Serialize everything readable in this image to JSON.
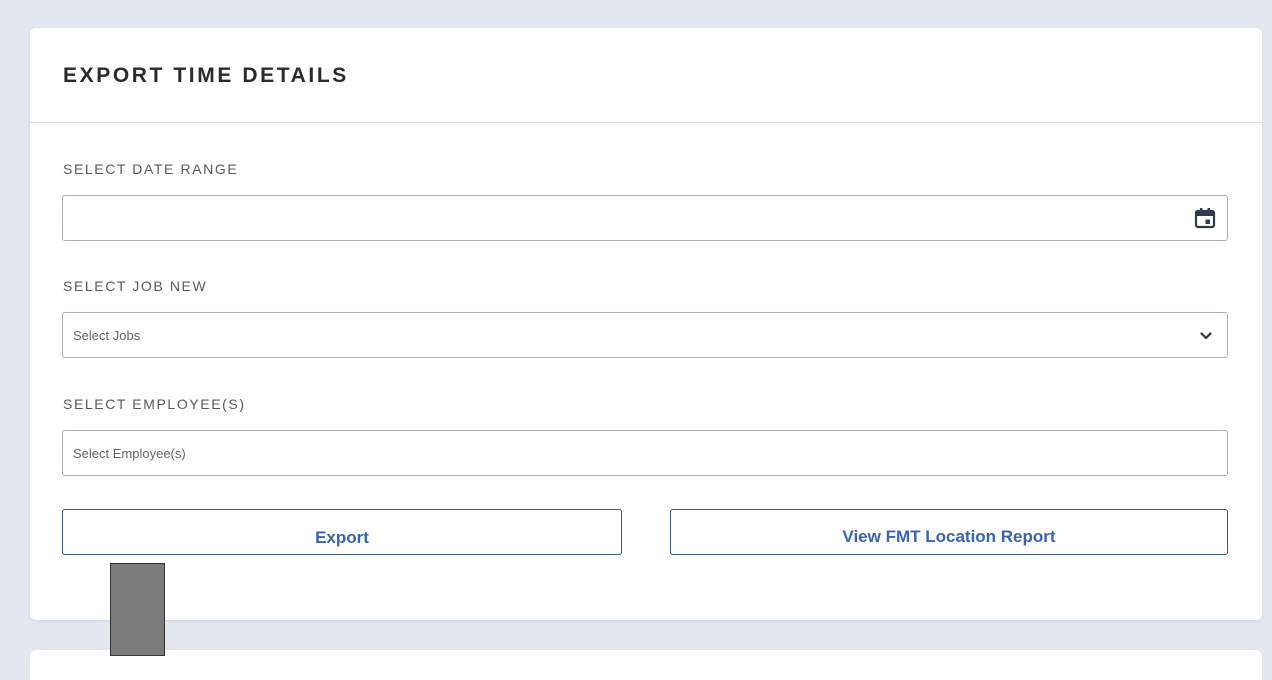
{
  "panel": {
    "title": "EXPORT TIME DETAILS"
  },
  "fields": {
    "date_range": {
      "label": "SELECT DATE RANGE",
      "value": "",
      "icon": "calendar-icon"
    },
    "job": {
      "label": "SELECT JOB NEW",
      "placeholder": "Select Jobs",
      "icon": "chevron-down-icon"
    },
    "employees": {
      "label": "SELECT EMPLOYEE(S)",
      "placeholder": "Select Employee(s)"
    }
  },
  "actions": {
    "export_label": "Export",
    "fmt_report_label": "View FMT Location Report"
  },
  "colors": {
    "page_background": "#e3e7f0",
    "card_background": "#ffffff",
    "button_text": "#3a64b0",
    "button_border": "#3a5a8c",
    "input_border": "#a9aeb8"
  }
}
